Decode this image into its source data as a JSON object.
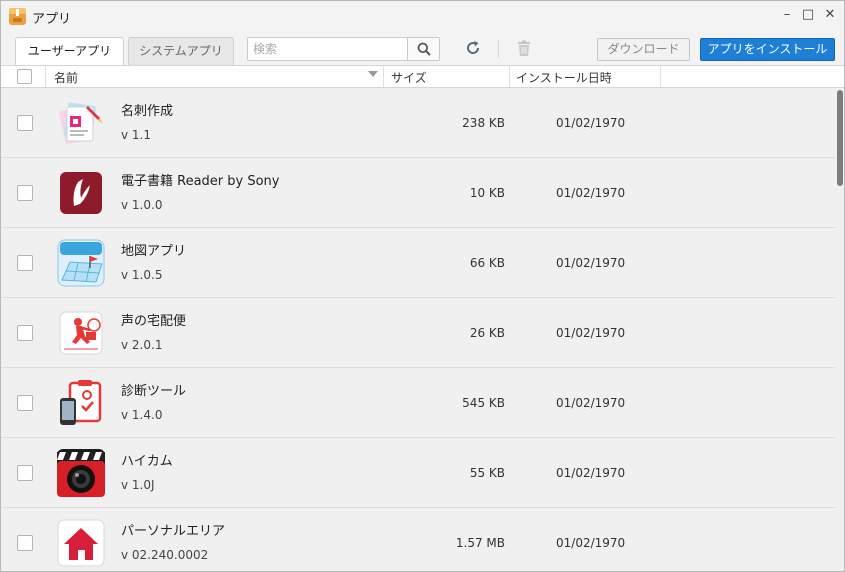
{
  "window": {
    "title": "アプリ",
    "icon": "app-box-icon"
  },
  "tabs": {
    "user": "ユーザーアプリ",
    "system": "システムアプリ"
  },
  "search": {
    "placeholder": "検索",
    "value": ""
  },
  "toolbar": {
    "download_label": "ダウンロード",
    "install_label": "アプリをインストール"
  },
  "columns": {
    "name": "名前",
    "size": "サイズ",
    "date": "インストール日時"
  },
  "colors": {
    "accent": "#1e7fd6",
    "row_bg": "#f0f0f0"
  },
  "apps": [
    {
      "name": "名刺作成",
      "version": "v 1.1",
      "size": "238 KB",
      "date": "01/02/1970",
      "icon": "business-card-maker-icon"
    },
    {
      "name": "電子書籍 Reader by Sony",
      "version": "v 1.0.0",
      "size": "10 KB",
      "date": "01/02/1970",
      "icon": "reader-by-sony-icon"
    },
    {
      "name": "地図アプリ",
      "version": "v 1.0.5",
      "size": "66 KB",
      "date": "01/02/1970",
      "icon": "map-app-icon"
    },
    {
      "name": "声の宅配便",
      "version": "v 2.0.1",
      "size": "26 KB",
      "date": "01/02/1970",
      "icon": "voice-delivery-icon"
    },
    {
      "name": "診断ツール",
      "version": "v 1.4.0",
      "size": "545 KB",
      "date": "01/02/1970",
      "icon": "diagnostic-tool-icon"
    },
    {
      "name": "ハイカム",
      "version": "v 1.0J",
      "size": "55 KB",
      "date": "01/02/1970",
      "icon": "highcam-icon"
    },
    {
      "name": "パーソナルエリア",
      "version": "v 02.240.0002",
      "size": "1.57 MB",
      "date": "01/02/1970",
      "icon": "personal-area-icon"
    }
  ]
}
